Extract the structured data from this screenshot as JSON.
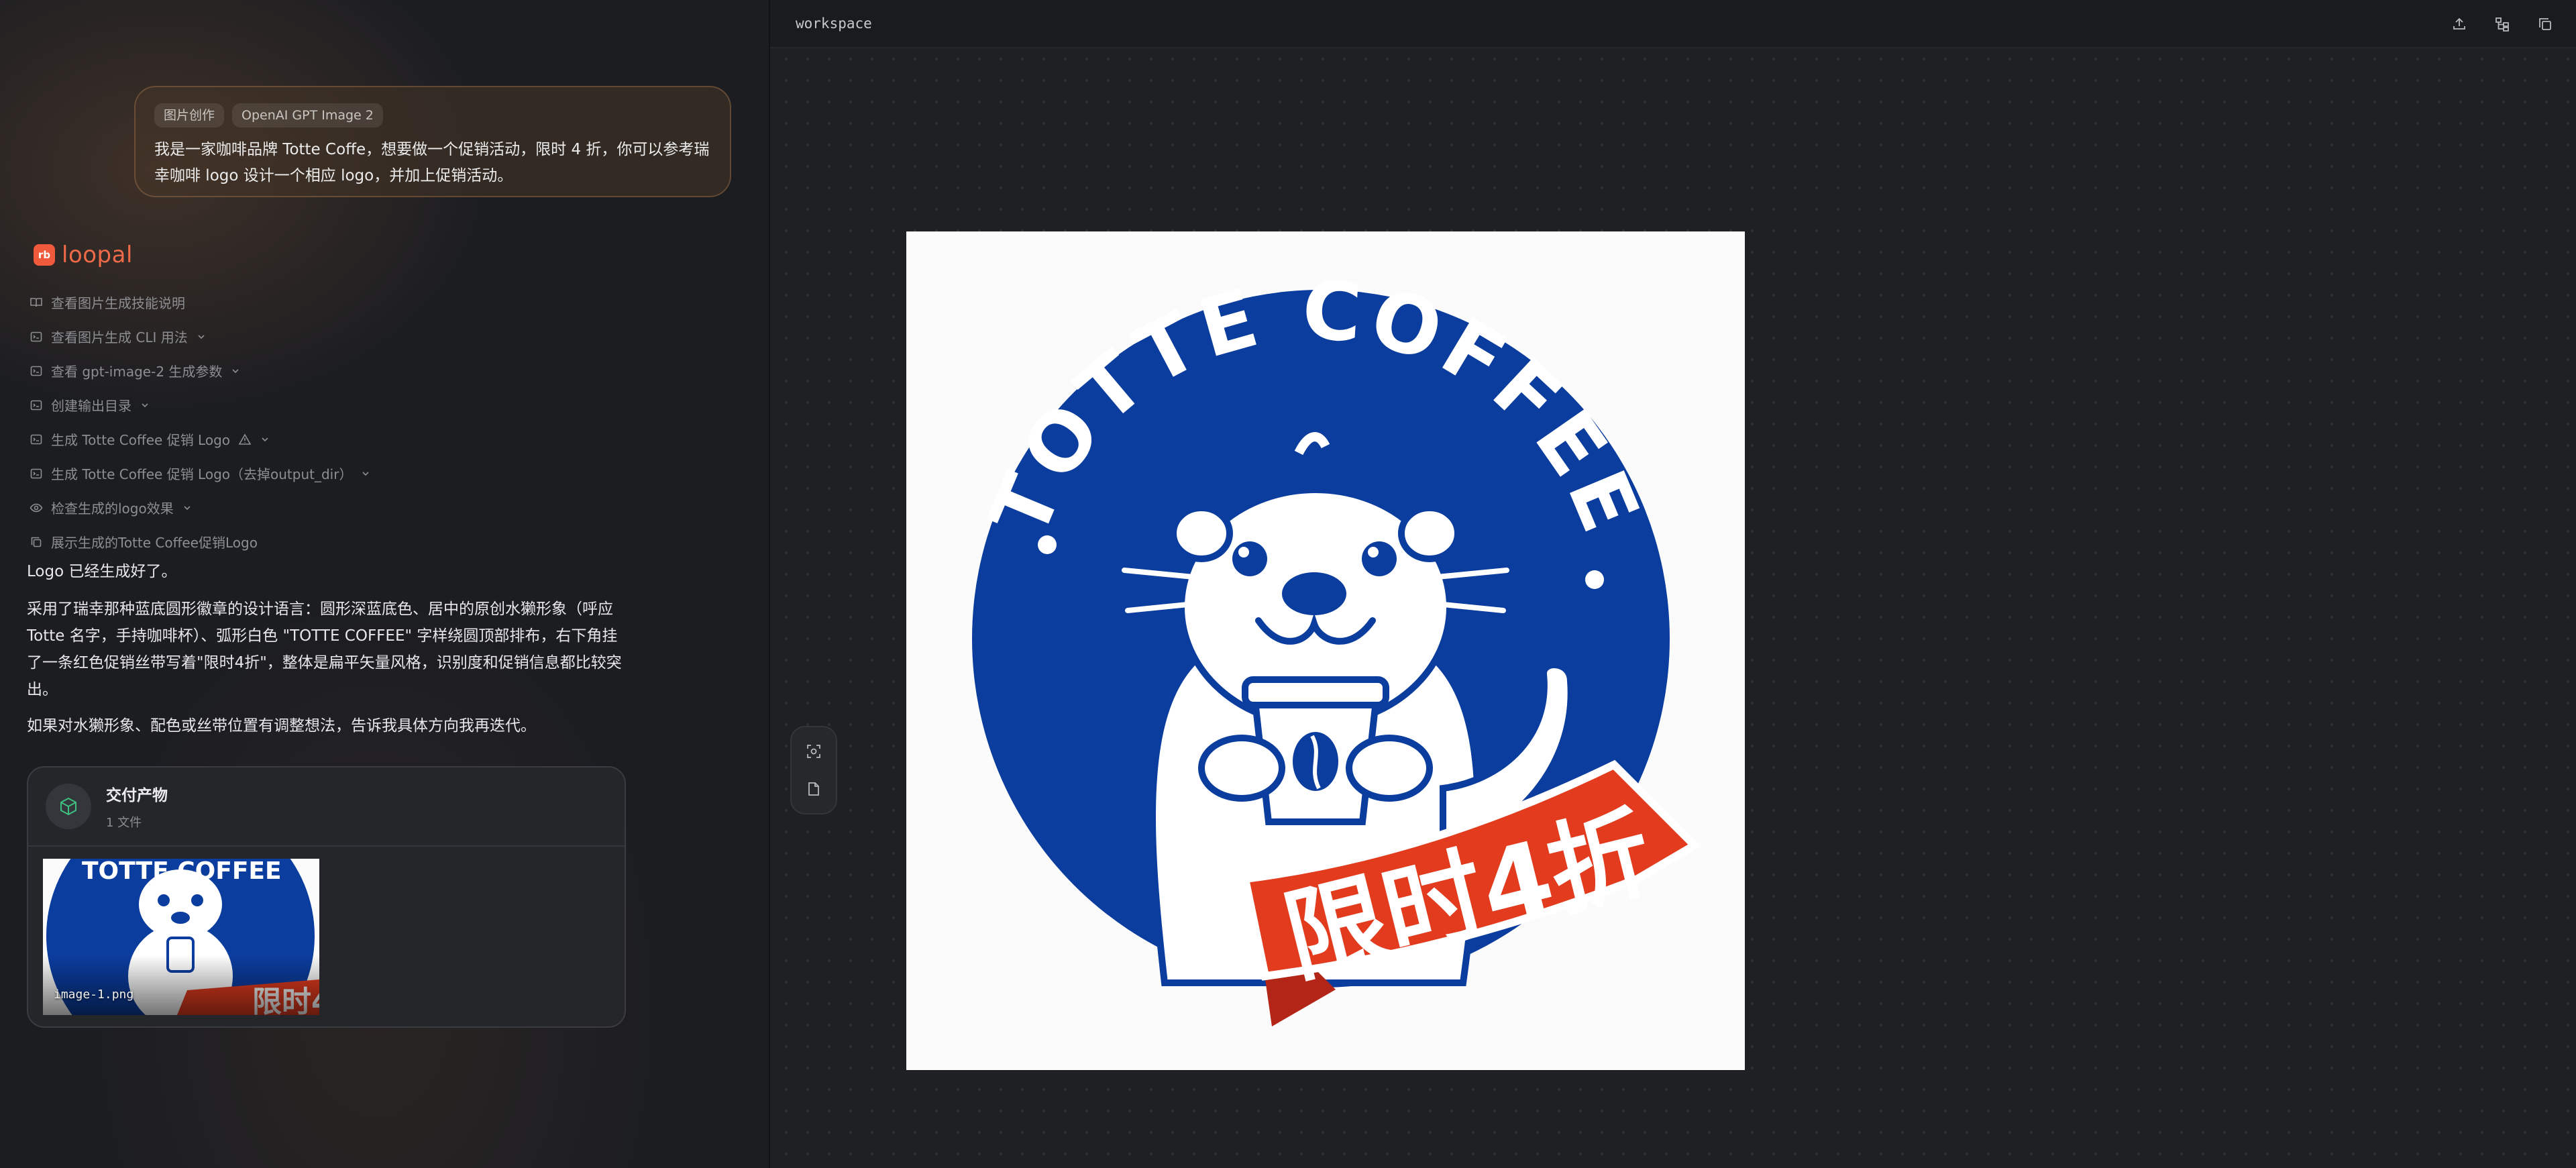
{
  "prompt": {
    "tags": [
      "图片创作",
      "OpenAI GPT Image 2"
    ],
    "text": "我是一家咖啡品牌 Totte Coffe，想要做一个促销活动，限时 4 折，你可以参考瑞幸咖啡 logo 设计一个相应 logo，并加上促销活动。"
  },
  "brand": {
    "mark": "rb",
    "name": "loopal"
  },
  "steps": [
    {
      "label": "查看图片生成技能说明",
      "icon": "book-icon",
      "chevron": false,
      "warning": false
    },
    {
      "label": "查看图片生成 CLI 用法",
      "icon": "terminal-icon",
      "chevron": true,
      "warning": false
    },
    {
      "label": "查看 gpt-image-2 生成参数",
      "icon": "terminal-icon",
      "chevron": true,
      "warning": false
    },
    {
      "label": "创建输出目录",
      "icon": "terminal-icon",
      "chevron": true,
      "warning": false
    },
    {
      "label": "生成 Totte Coffee 促销 Logo",
      "icon": "terminal-icon",
      "chevron": true,
      "warning": true
    },
    {
      "label": "生成 Totte Coffee 促销 Logo（去掉output_dir）",
      "icon": "terminal-icon",
      "chevron": true,
      "warning": false
    },
    {
      "label": "检查生成的logo效果",
      "icon": "eye-icon",
      "chevron": true,
      "warning": false
    },
    {
      "label": "展示生成的Totte Coffee促销Logo",
      "icon": "copy-icon",
      "chevron": false,
      "warning": false
    }
  ],
  "reply": {
    "p1": "Logo 已经生成好了。",
    "p2": "采用了瑞幸那种蓝底圆形徽章的设计语言：圆形深蓝底色、居中的原创水獭形象（呼应 Totte 名字，手持咖啡杯）、弧形白色 \"TOTTE COFFEE\" 字样绕圆顶部排布，右下角挂了一条红色促销丝带写着\"限时4折\"，整体是扁平矢量风格，识别度和促销信息都比较突出。",
    "p3": "如果对水獭形象、配色或丝带位置有调整想法，告诉我具体方向我再迭代。"
  },
  "deliverable": {
    "title": "交付产物",
    "count": "1 文件",
    "file_name": "image-1.png"
  },
  "workspace": {
    "title": "workspace",
    "actions": [
      "upload-icon",
      "tree-icon",
      "copy-icon"
    ],
    "tools": [
      "scan-icon",
      "file-icon"
    ]
  },
  "logo": {
    "arc_text": "TOTTE COFFEE",
    "ribbon_text": "限时4折",
    "colors": {
      "blue": "#0b3d9f",
      "red": "#e23b1e",
      "dark_red": "#b32516",
      "white": "#ffffff"
    }
  },
  "colors": {
    "accent": "#ef6a48",
    "panel_bg": "#1c1d21",
    "workspace_bg": "#1f2023"
  }
}
